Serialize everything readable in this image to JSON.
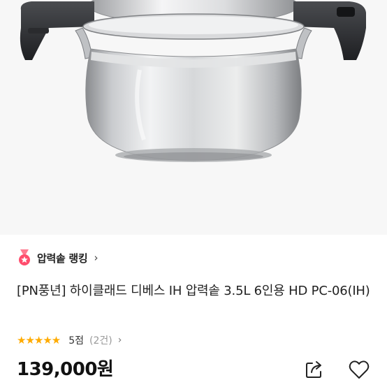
{
  "product": {
    "ranking_label": "압력솥 랭킹",
    "title": "[PN풍년] 하이클래드 디베스 IH 압력솥 3.5L 6인용 HD PC-06(IH)",
    "rating_stars": "★★★★★",
    "rating_score": "5점",
    "review_count": "(2건)",
    "price": "139,000원"
  },
  "icons": {
    "ranking": "medal-icon",
    "ranking_chevron": "chevron-right-icon",
    "rating_chevron": "chevron-right-icon",
    "share": "share-icon",
    "like": "heart-icon"
  },
  "colors": {
    "star": "#ffab00",
    "medal": "#ff4d6d",
    "text": "#222222",
    "muted": "#999999"
  }
}
